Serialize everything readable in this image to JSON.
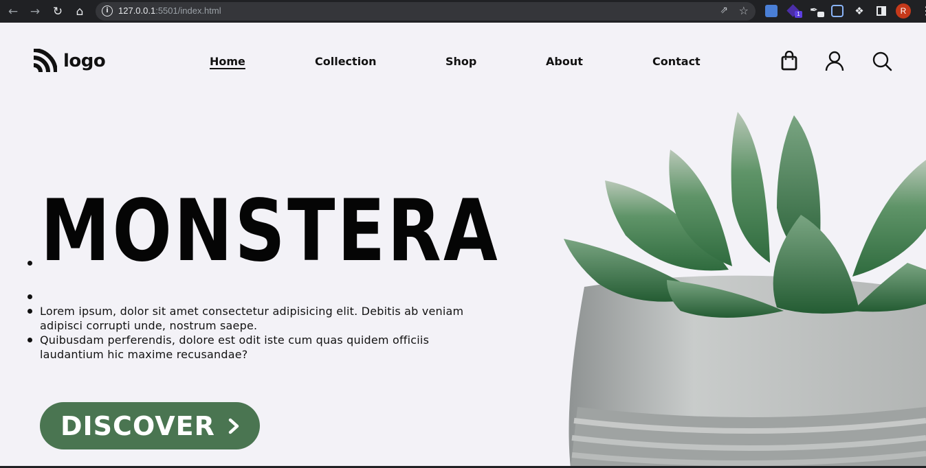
{
  "browser": {
    "url_host": "127.0.0.1",
    "url_path": ":5501/index.html",
    "profile_initial": "R",
    "extension_badge": "1"
  },
  "header": {
    "logo_text": "logo",
    "nav": [
      {
        "label": "Home",
        "active": true
      },
      {
        "label": "Collection",
        "active": false
      },
      {
        "label": "Shop",
        "active": false
      },
      {
        "label": "About",
        "active": false
      },
      {
        "label": "Contact",
        "active": false
      }
    ],
    "icons": [
      "shopping-bag-icon",
      "user-icon",
      "search-icon"
    ]
  },
  "hero": {
    "title": "MONSTERA",
    "paragraphs": [
      "Lorem ipsum, dolor sit amet consectetur adipisicing elit. Debitis ab veniam adipisci corrupti unde, nostrum saepe.",
      "Quibusdam perferendis, dolore est odit iste cum quas quidem officiis laudantium hic maxime recusandae?"
    ],
    "button_label": "DISCOVER",
    "button_icon": "chevron-right-icon"
  },
  "colors": {
    "page_bg": "#f3f2f7",
    "accent_green": "#4a7551",
    "text": "#111111"
  }
}
